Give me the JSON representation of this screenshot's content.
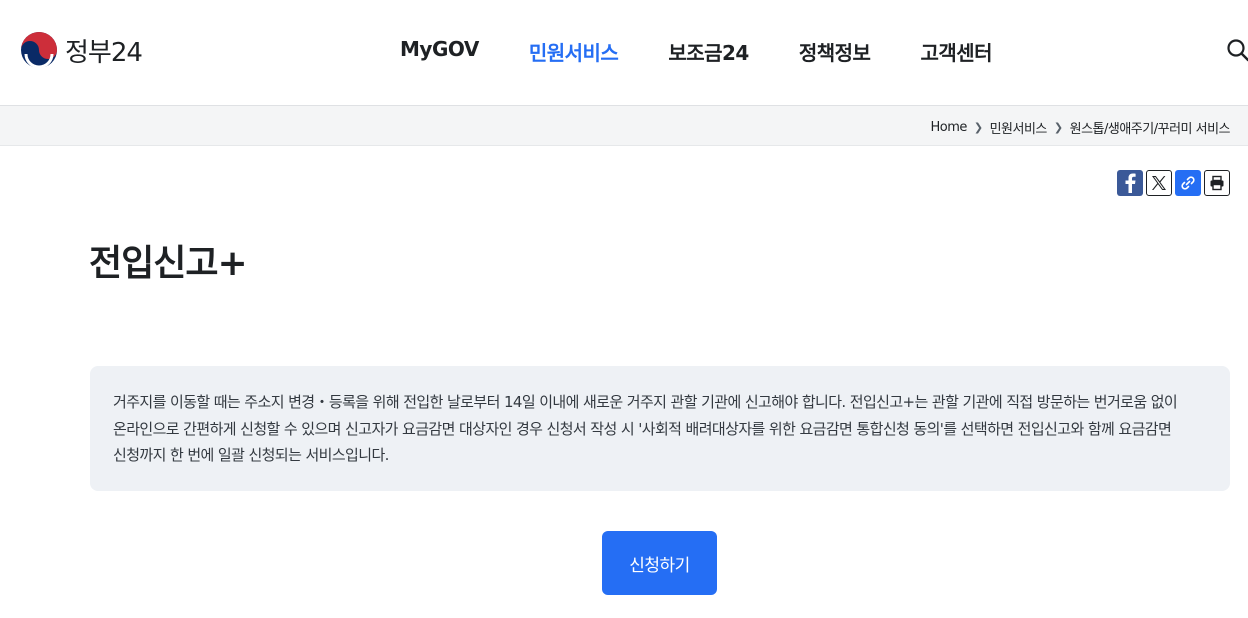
{
  "header": {
    "logo_text": "정부24",
    "nav": [
      {
        "label": "MyGOV",
        "active": false
      },
      {
        "label": "민원서비스",
        "active": true
      },
      {
        "label": "보조금24",
        "active": false
      },
      {
        "label": "정책정보",
        "active": false
      },
      {
        "label": "고객센터",
        "active": false
      }
    ],
    "search_icon": "search-icon"
  },
  "breadcrumb": [
    "Home",
    "민원서비스",
    "원스톱/생애주기/꾸러미 서비스"
  ],
  "share": {
    "icons": [
      "facebook-icon",
      "x-icon",
      "link-icon",
      "print-icon"
    ]
  },
  "page": {
    "title": "전입신고+",
    "description": "거주지를 이동할 때는 주소지 변경・등록을 위해 전입한 날로부터 14일 이내에 새로운 거주지 관할 기관에 신고해야 합니다. 전입신고+는 관할 기관에 직접 방문하는 번거로움 없이 온라인으로 간편하게 신청할 수 있으며 신고자가 요금감면 대상자인 경우 신청서 작성 시 '사회적 배려대상자를 위한 요금감면 통합신청 동의'를 선택하면 전입신고와 함께 요금감면 신청까지 한 번에 일괄 신청되는 서비스입니다.",
    "apply_label": "신청하기"
  },
  "colors": {
    "accent": "#256ef4",
    "text": "#1e2124",
    "box_bg": "#eef1f5",
    "facebook": "#3b5998"
  }
}
